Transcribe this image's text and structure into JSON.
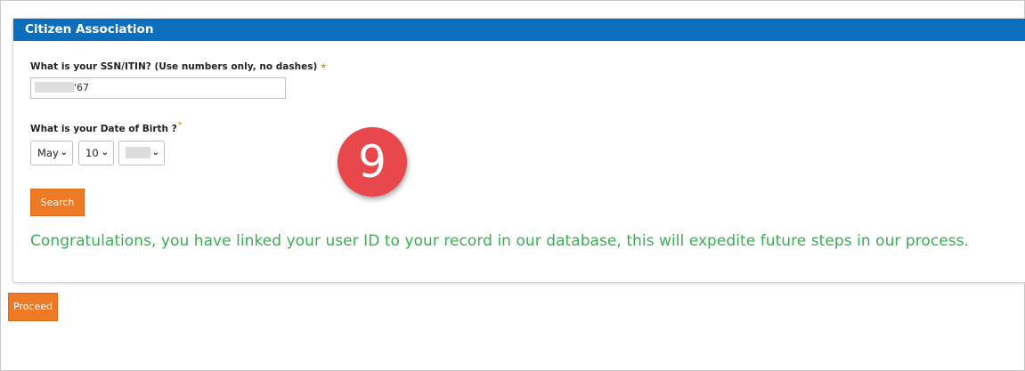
{
  "panel": {
    "title": "Citizen Association"
  },
  "ssn": {
    "label": "What is your SSN/ITIN? (Use numbers only, no dashes)",
    "required_marker": "★",
    "value_visible_suffix": "'67"
  },
  "dob": {
    "label": "What is your Date of Birth ?",
    "required_marker": "*",
    "month": "May",
    "day": "10",
    "chevron": "⌄"
  },
  "search_label": "Search",
  "success_message": "Congratulations, you have linked your user ID to your record in our database, this will expedite future steps in our process.",
  "step_badge": "9",
  "proceed_label": "Proceed",
  "colors": {
    "header": "#0b6fbd",
    "button": "#ee7a26",
    "success": "#3aae52",
    "badge": "#e8474b"
  }
}
